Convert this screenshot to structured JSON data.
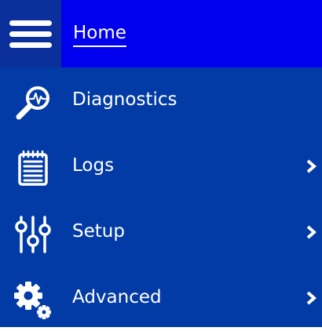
{
  "header": {
    "menu_icon": "hamburger-menu-icon",
    "home_label": "Home"
  },
  "menu": {
    "items": [
      {
        "label": "Diagnostics",
        "icon": "magnifier-pulse-icon",
        "has_submenu": false
      },
      {
        "label": "Logs",
        "icon": "notepad-icon",
        "has_submenu": true
      },
      {
        "label": "Setup",
        "icon": "sliders-icon",
        "has_submenu": true
      },
      {
        "label": "Advanced",
        "icon": "gears-icon",
        "has_submenu": true
      }
    ]
  },
  "colors": {
    "header_bg": "#0000ee",
    "menu_bg": "#023ba5",
    "hamburger_bg": "#0b2f9b",
    "text": "#ffffff"
  }
}
